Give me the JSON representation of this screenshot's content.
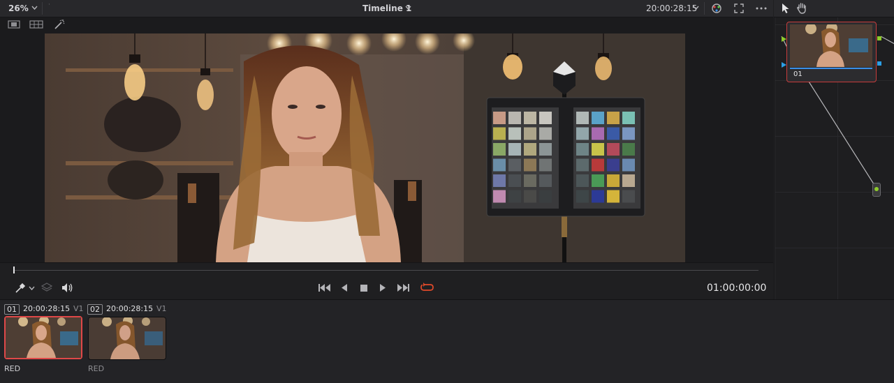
{
  "toolbar": {
    "zoom": "26%",
    "timeline_name": "Timeline 1",
    "timecode": "20:00:28:15"
  },
  "transport": {
    "timecode": "01:00:00:00"
  },
  "node": {
    "label": "01"
  },
  "clips": [
    {
      "number": "01",
      "timecode": "20:00:28:15",
      "track": "V1",
      "codec": "RED",
      "selected": true
    },
    {
      "number": "02",
      "timecode": "20:00:28:15",
      "track": "V1",
      "codec": "RED",
      "selected": false
    }
  ],
  "colors": {
    "accent_red": "#e04848",
    "node_border": "#c83c3c",
    "node_green": "#8fcc2c",
    "node_blue": "#2c9fe6",
    "loop_active": "#e04a2a"
  },
  "icons": [
    "chevron-down-icon",
    "color-wheel-icon",
    "fullscreen-icon",
    "more-icon",
    "pointer-icon",
    "hand-icon",
    "single-viewer-icon",
    "grid-viewer-icon",
    "magic-wand-icon",
    "eyedropper-icon",
    "layers-icon",
    "speaker-icon",
    "skip-start-icon",
    "step-back-icon",
    "stop-icon",
    "play-icon",
    "skip-end-icon",
    "loop-icon"
  ]
}
